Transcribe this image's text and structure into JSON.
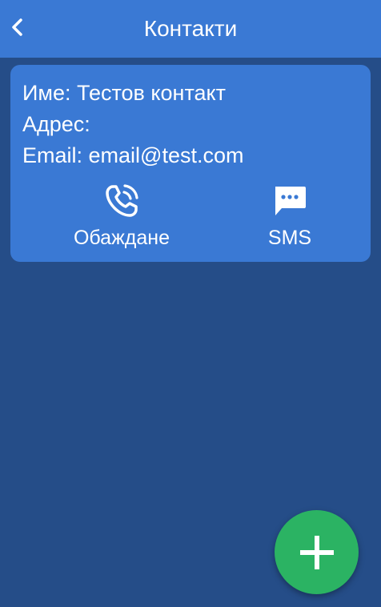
{
  "header": {
    "title": "Контакти",
    "back_icon": "chevron-left-icon"
  },
  "contact": {
    "name_line": "Име: Тестов контакт",
    "address_line": "Адрес:",
    "email_line": "Email: email@test.com"
  },
  "actions": {
    "call_label": "Обаждане",
    "call_icon": "phone-icon",
    "sms_label": "SMS",
    "sms_icon": "message-icon"
  },
  "fab": {
    "icon": "plus-icon"
  },
  "colors": {
    "background": "#254d88",
    "header": "#3a79d4",
    "card": "#3a79d4",
    "fab": "#2bb363",
    "text": "#ffffff"
  }
}
